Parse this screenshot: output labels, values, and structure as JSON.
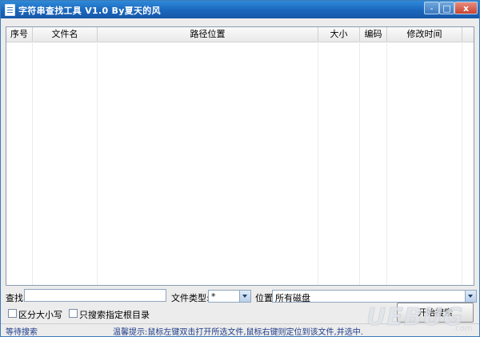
{
  "window": {
    "title": "字符串查找工具 V1.0 By夏天的风",
    "controls": {
      "minimize": "-",
      "maximize": "□",
      "close": "x"
    }
  },
  "list": {
    "columns": [
      "序号",
      "文件名",
      "路径位置",
      "大小",
      "编码",
      "修改时间"
    ],
    "rows": []
  },
  "search": {
    "label": "查找:",
    "value": "",
    "filetype_label": "文件类型:",
    "filetype_value": "*",
    "location_label": "位置:",
    "location_value": "所有磁盘"
  },
  "options": {
    "case_sensitive": {
      "label": "区分大小写",
      "checked": false
    },
    "root_only": {
      "label": "只搜索指定根目录",
      "checked": false
    }
  },
  "start_button": "开始搜索",
  "status": {
    "left": "等待搜索",
    "hint": "温馨提示:鼠标左键双击打开所选文件,鼠标右键则定位到该文件,并选中."
  },
  "watermark": {
    "brand": "UEBUG",
    "sub": ".com"
  },
  "colors": {
    "titlebar": "#1a66bd",
    "status_text": "#1f3d8a",
    "close": "#c94430"
  }
}
